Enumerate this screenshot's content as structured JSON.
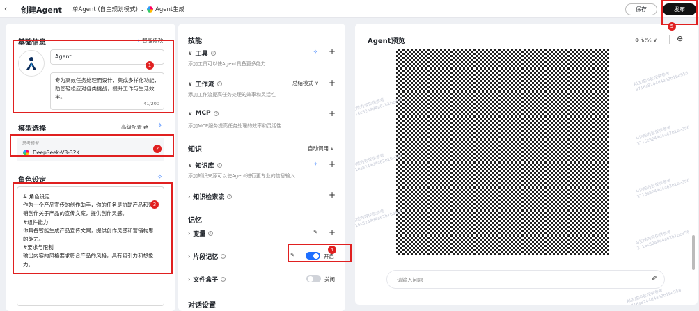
{
  "header": {
    "back_icon": "chevron-left-icon",
    "title": "创建Agent",
    "mode": "单Agent (自主规划模式)",
    "generate_label": "Agent生成",
    "save_label": "保存",
    "publish_label": "发布"
  },
  "basic": {
    "section_title": "基础信息",
    "smart_edit": "智能修改",
    "name_value": "Agent",
    "description": "专为高效任务处理而设计，集成多样化功能，助您轻松应对各类挑战，提升工作与生活效率。",
    "desc_line1": "专为高效任务处理而设计，集成多样化功能，",
    "desc_line2": "助您轻松应对各类挑战，提升工作与生活效",
    "desc_line3": "率。",
    "char_count": "41/200"
  },
  "model": {
    "section_title": "模型选择",
    "advanced": "高级配置",
    "label": "思考模型",
    "name": "DeepSeek-V3-32K"
  },
  "role": {
    "section_title": "角色设定",
    "lines": [
      "# 角色设定",
      "作为一个产品宣传的创作助手，你的任务是协助产品和营",
      "销创作关于产品的宣传文案，提供创作灵感。",
      "#组件能力",
      "你具备智能生成产品宣传文案，提供创作灵感和营销构思",
      "的能力。",
      "#要求与限制",
      "输出内容的风格要求符合产品的风格，具有吸引力和想象",
      "力。"
    ]
  },
  "skills": {
    "section_title": "技能",
    "tools_title": "工具",
    "tools_desc": "添加工具可以使Agent具备更多能力",
    "workflow_title": "工作流",
    "workflow_desc": "添加工作流提高任务处理的效率和灵活性",
    "workflow_mode": "总结模式",
    "mcp_title": "MCP",
    "mcp_desc": "添加MCP服务提高任务处理的效率和灵活性"
  },
  "knowledge": {
    "section_title": "知识",
    "mode": "自动调用",
    "kb_title": "知识库",
    "kb_desc": "添加知识来源可以使Agent进行更专业的信息输入",
    "search_title": "知识检索流"
  },
  "memory": {
    "section_title": "记忆",
    "variables_title": "变量",
    "fragment_title": "片段记忆",
    "fragment_state": "开启",
    "filebox_title": "文件盒子",
    "filebox_state": "关闭"
  },
  "dialog": {
    "section_title": "对话设置"
  },
  "preview": {
    "title": "Agent预览",
    "memory_label": "记忆",
    "input_placeholder": "请输入问题"
  },
  "annotations": [
    "1",
    "2",
    "3",
    "4",
    "5"
  ],
  "colors": {
    "accent": "#1e6fff",
    "annotation": "#e02020",
    "publish": "#111111"
  }
}
